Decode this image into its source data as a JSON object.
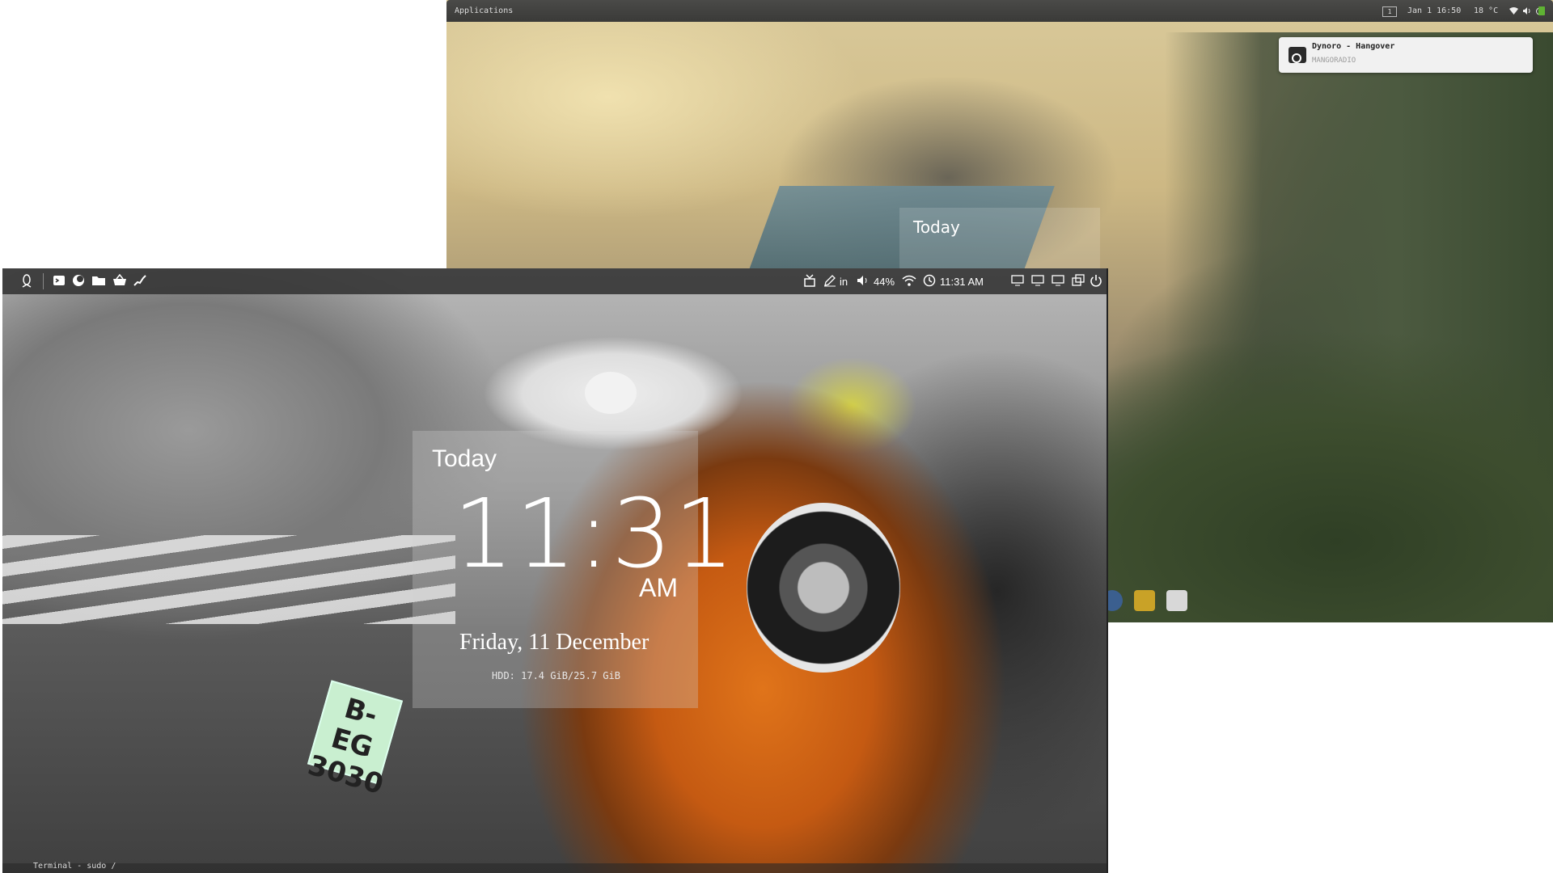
{
  "back_window": {
    "topbar": {
      "applications_label": "Applications",
      "workspace_number": "1",
      "datetime": "Jan 1 16:50",
      "temperature": "18 °C"
    },
    "notification": {
      "title": "Dynoro - Hangover",
      "subtitle": "MANGORADIO"
    },
    "today_widget": {
      "label": "Today"
    }
  },
  "front_window": {
    "topbar": {
      "input_label": "in",
      "volume_label": "44%",
      "clock_label": "11:31 AM"
    },
    "today_widget": {
      "label": "Today",
      "time": "11:31",
      "ampm": "AM",
      "date": "Friday, 11 December",
      "hdd": "HDD: 17.4 GiB/25.7 GiB"
    },
    "plate_text": "B-EG 3030",
    "taskbar": {
      "item_label": "Terminal - sudo /"
    }
  },
  "colors": {
    "front_bar": "#373737",
    "notification_bg": "#f1f1f1",
    "scooter_orange": "#e0741a"
  }
}
